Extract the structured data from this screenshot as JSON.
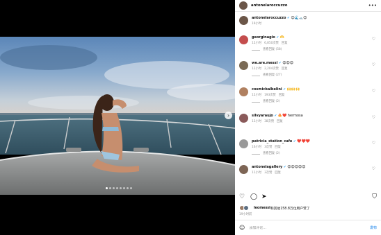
{
  "post": {
    "author": "antonelaroccuzzo",
    "caption_emojis": "😊🌊🛥️😊",
    "caption_time": "19小时",
    "slide_count": 8,
    "active_slide": 1
  },
  "comments": [
    {
      "user": "georginagio",
      "text": "🫶",
      "time": "12小时",
      "likes": "6,850次赞",
      "reply": "回复",
      "view_replies": "查看回复 (58)",
      "avatar_color": "#c44d4d"
    },
    {
      "user": "we.are.messi",
      "text": "😍😍😍",
      "time": "12小时",
      "likes": "2,204次赞",
      "reply": "回复",
      "view_replies": "查看回复 (27)",
      "avatar_color": "#7a6a55"
    },
    {
      "user": "cosmicbalbelini",
      "text": "🙌🙌🙌",
      "time": "12小时",
      "likes": "193次赞",
      "reply": "回复",
      "view_replies": "查看回复 (2)",
      "avatar_color": "#b08060"
    },
    {
      "user": "silvyaraujo",
      "text": "🔥❤️ hermosa",
      "time": "13小时",
      "likes": "38次赞",
      "reply": "回复",
      "view_replies": "",
      "avatar_color": "#8a5a5a"
    },
    {
      "user": "patricia_station_cafe",
      "text": "❤️❤️❤️",
      "time": "16小时",
      "likes": "3次赞",
      "reply": "回复",
      "view_replies": "查看回复 (2)",
      "avatar_color": "#999999"
    },
    {
      "user": "antonelagallery",
      "text": "😍😍😍😍😍",
      "time": "11小时",
      "likes": "3次赞",
      "reply": "回复",
      "view_replies": "",
      "avatar_color": "#7d6555"
    }
  ],
  "actions": {
    "like_icon": "heart-icon",
    "comment_icon": "comment-icon",
    "share_icon": "send-icon",
    "save_icon": "bookmark-icon"
  },
  "likes_line": {
    "user": "leomessi",
    "rest": "和其他158.8万位用户赞了"
  },
  "post_time": "19小时前",
  "composer": {
    "placeholder": "添加评论...",
    "post_label": "发布"
  },
  "colors": {
    "verified": "#1d9bf0",
    "post_button": "#5aa6f0"
  }
}
